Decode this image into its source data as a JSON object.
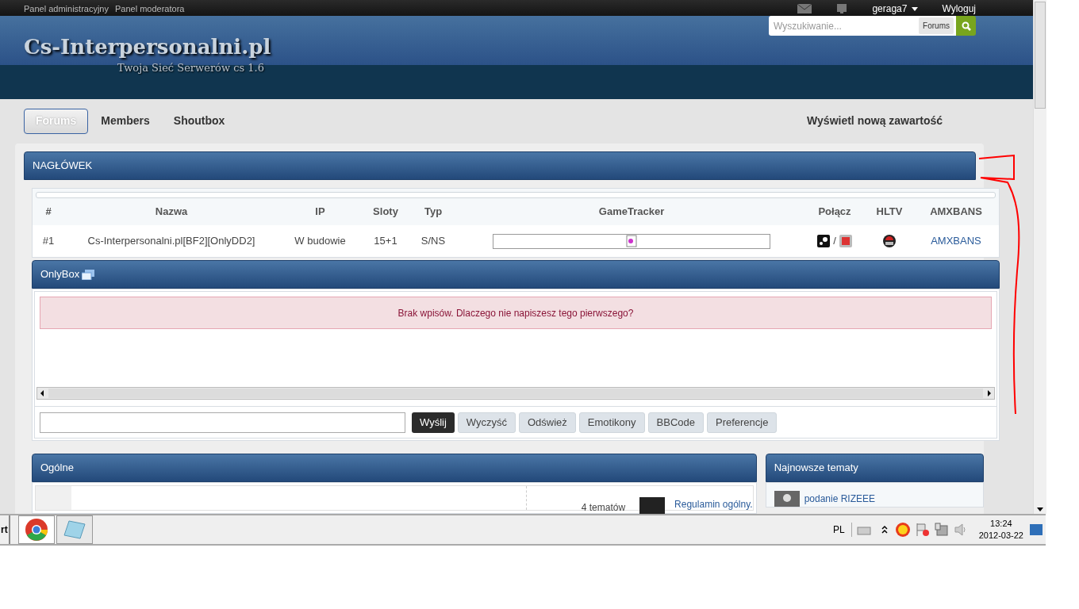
{
  "top_bar": {
    "links": [
      "Panel administracyjny",
      "Panel moderatora"
    ],
    "user": "geraga7",
    "logout": "Wyloguj"
  },
  "header": {
    "logo_title": "Cs-Interpersonalni.pl",
    "logo_subtitle": "Twoja Sieć Serwerów cs 1.6",
    "search": {
      "placeholder": "Wyszukiwanie...",
      "scope": "Forums"
    }
  },
  "nav": {
    "tabs": [
      {
        "label": "Forums",
        "selected": true
      },
      {
        "label": "Members",
        "selected": false
      },
      {
        "label": "Shoutbox",
        "selected": false
      }
    ],
    "new_content": "Wyświetl nową zawartość"
  },
  "servers": {
    "title": "NAGŁÓWEK",
    "columns": [
      "#",
      "Nazwa",
      "IP",
      "Sloty",
      "Typ",
      "GameTracker",
      "Połącz",
      "HLTV",
      "AMXBANS"
    ],
    "rows": [
      {
        "number": "#1",
        "name": "Cs-Interpersonalni.pl[BF2][OnlyDD2]",
        "ip": "W budowie",
        "slots": "15+1",
        "type": "S/NS",
        "separator": "/",
        "amxbans": "AMXBANS"
      }
    ]
  },
  "shoutbox": {
    "title": "OnlyBox",
    "message": "Brak wpisów. Dlaczego nie napiszesz tego pierwszego?",
    "buttons": [
      {
        "label": "Wyślij",
        "primary": true
      },
      {
        "label": "Wyczyść",
        "primary": false
      },
      {
        "label": "Odśwież",
        "primary": false
      },
      {
        "label": "Emotikony",
        "primary": false
      },
      {
        "label": "BBCode",
        "primary": false
      },
      {
        "label": "Preferencje",
        "primary": false
      }
    ]
  },
  "category": {
    "title": "Ogólne",
    "topics_count": "4 tematów",
    "last_post": "Regulamin ogólny."
  },
  "latest": {
    "title": "Najnowsze tematy",
    "items": [
      "podanie RIZEEE"
    ]
  },
  "taskbar": {
    "start": "rt",
    "language": "PL",
    "time": "13:24",
    "date": "2012-03-22"
  }
}
